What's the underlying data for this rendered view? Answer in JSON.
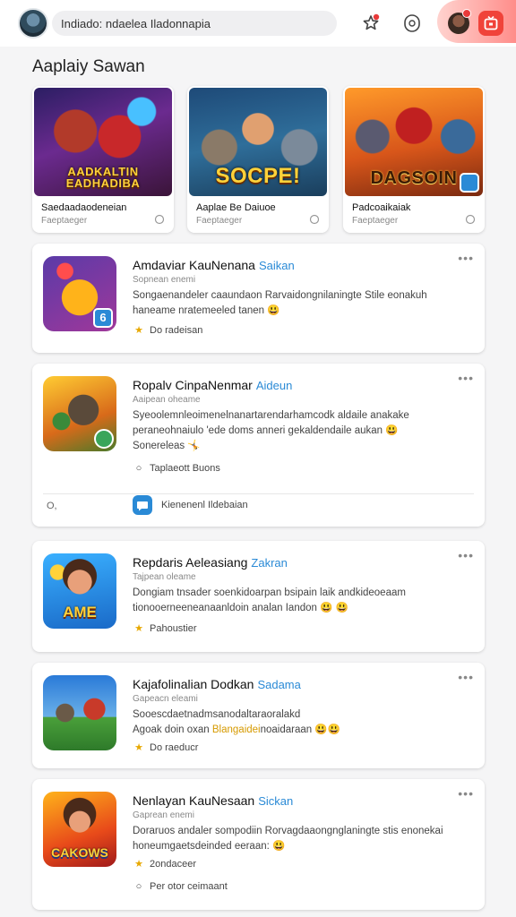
{
  "header": {
    "search_text": "Indiado: ndaelea Iladonnapia",
    "star_icon": "star-badge-icon",
    "circle_icon": "circle-outline-icon",
    "tv_icon": "tv-icon"
  },
  "section": {
    "title": "Aaplaiy Sawan"
  },
  "featured": [
    {
      "art_title": "AADKALTIN\nEADHADIBA",
      "name": "Saedaadaodeneian",
      "sub": "Faeptaeger"
    },
    {
      "art_title": "SOCPE!",
      "name": "Aaplae Be Daiuoe",
      "sub": "Faeptaeger"
    },
    {
      "art_title": "DAGSOIN",
      "name": "Padcoaikaiak",
      "sub": "Faeptaeger"
    }
  ],
  "cards": [
    {
      "title": "Amdaviar KauNenana",
      "tag": "Saikan",
      "meta": "Sopnean enemi",
      "desc1": "Songaenandeler caaundaon Rarvaidongnilaningte Stile eonakuh",
      "desc2": "haneame nratemeeled tanen 😃",
      "stat": "Do radeisan"
    },
    {
      "title": "Ropalv CinpaNenmar",
      "tag": "Aideun",
      "meta": "Aaipean oheame",
      "desc1": "Syeoolemnleoimenelnanartarendarhamcodk aldaile anakake",
      "desc2": "peraneohnaiulo 'ede doms anneri gekaldendaile aukan 😃",
      "desc3": "Sonereleas 🤸",
      "radio": "Taplaeott Buons",
      "foot_left": "O,",
      "foot_label": "Kienenenl Ildebaian"
    },
    {
      "title": "Repdaris Aeleasiang",
      "tag": "Zakran",
      "meta": "Tajpean oleame",
      "desc1": "Dongiam tnsader soenkidoarpan bsipain laik andkideoeaam",
      "desc2": "tionooerneeneanaanldoin analan Iandon 😃 😃",
      "stat": "Pahoustier"
    },
    {
      "title": "Kajafolinalian Dodkan",
      "tag": "Sadama",
      "meta": "Gapeacn eleami",
      "desc1": "Sooescdaetnadmsanodaltaraoralakd",
      "desc2": "Agoak doin oxan",
      "desc2_highlight": "Blangaidei",
      "desc2_tail": "noaidaraan 😃😃",
      "stat": "Do raeducr"
    },
    {
      "title": "Nenlayan KauNesaan",
      "tag": "Sickan",
      "meta": "Gaprean enemi",
      "desc1": "Doraruos andaler sompodiin Rorvagdaaongnglaningte stis enonekai",
      "desc2": "honeumgaetsdeinded eeraan: 😃",
      "stat": "2ondaceer",
      "radio": "Per otor ceimaant"
    }
  ],
  "colors": {
    "accent_blue": "#2a8ad6",
    "badge_red": "#e83a3a",
    "star_yellow": "#e7a800"
  }
}
